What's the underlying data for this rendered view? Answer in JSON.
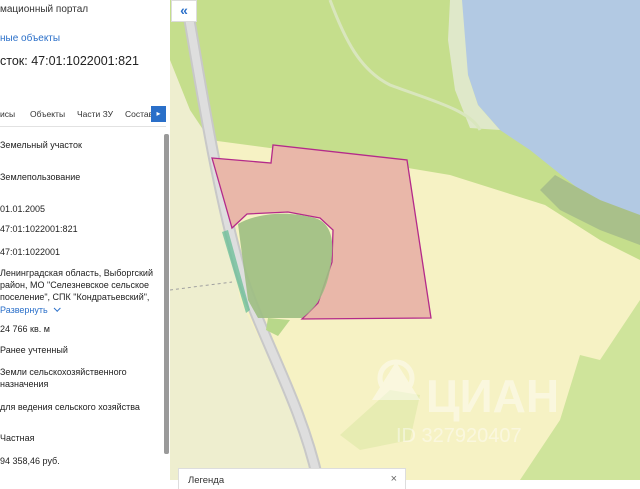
{
  "panel": {
    "title": "мационный портал",
    "objects_link": "ные объекты",
    "parcel_number": "сток: 47:01:1022001:821",
    "tabs": [
      "исы",
      "Объекты",
      "Части ЗУ",
      "Состав"
    ],
    "tab_arrow": "▸",
    "rows": {
      "type": "Земельный участок",
      "kind": "Землепользование",
      "date": "01.01.2005",
      "cad_number": "47:01:1022001:821",
      "quarter": "47:01:1022001",
      "address_line1": "Ленинградская область, Выборгский",
      "address_line2": "район, МО \"Селезневское сельское",
      "address_line3": "поселение\", СПК \"Кондратьевский\",",
      "expand_link": "Развернуть",
      "area": "24 766 кв. м",
      "status": "Ранее учтенный",
      "category_line1": "Земли сельскохозяйственного",
      "category_line2": "назначения",
      "use": "для ведения сельского хозяйства",
      "ownership": "Частная",
      "cost": "94 358,46 руб."
    },
    "scroll_fraction": 0.95
  },
  "map": {
    "collapse_symbol": "«",
    "legend_title": "Легенда",
    "legend_close": "×",
    "watermark": "ЦИАН",
    "watermark_id": "ID 327920407"
  },
  "colors": {
    "water": "#b2c9e3",
    "forest": "#c5de8c",
    "field": "#f6f2c4",
    "parcel_fill": "#e9b7a9",
    "parcel_border": "#b42a8a",
    "accent": "#2a6fc9"
  }
}
